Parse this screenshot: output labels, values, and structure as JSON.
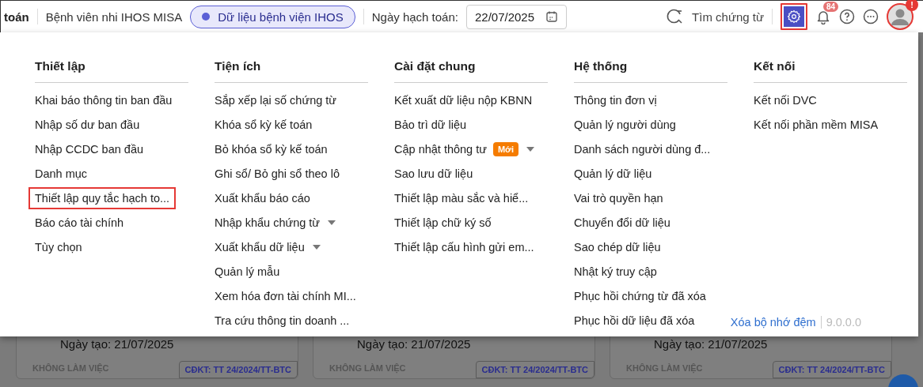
{
  "header": {
    "app_title": "toán",
    "unit_name": "Bệnh viên nhi IHOS MISA",
    "data_pill": "Dữ liệu bệnh viện IHOS",
    "date_label": "Ngày hạch toán:",
    "date_value": "22/07/2025",
    "search_label": "Tìm chứng từ",
    "settings_highlighted": true,
    "notification_count": "84",
    "avatar_alert": "!"
  },
  "menu": {
    "columns": [
      {
        "title": "Thiết lập",
        "items": [
          {
            "label": "Khai báo thông tin ban đầu"
          },
          {
            "label": "Nhập số dư ban đầu"
          },
          {
            "label": "Nhập CCDC ban đầu"
          },
          {
            "label": "Danh mục"
          },
          {
            "label": "Thiết lập quy tắc hạch to...",
            "highlighted": true
          },
          {
            "label": "Báo cáo tài chính"
          },
          {
            "label": "Tùy chọn"
          }
        ]
      },
      {
        "title": "Tiện ích",
        "items": [
          {
            "label": "Sắp xếp lại số chứng từ"
          },
          {
            "label": "Khóa sổ kỳ kế toán"
          },
          {
            "label": "Bỏ khóa sổ kỳ kế toán"
          },
          {
            "label": "Ghi sổ/ Bỏ ghi sổ theo lô"
          },
          {
            "label": "Xuất khẩu báo cáo"
          },
          {
            "label": "Nhập khẩu chứng từ",
            "caret": true
          },
          {
            "label": "Xuất khẩu dữ liệu",
            "caret": true
          },
          {
            "label": "Quản lý mẫu"
          },
          {
            "label": "Xem hóa đơn tài chính MI..."
          },
          {
            "label": "Tra cứu thông tin doanh ..."
          }
        ]
      },
      {
        "title": "Cài đặt chung",
        "items": [
          {
            "label": "Kết xuất dữ liệu nộp KBNN"
          },
          {
            "label": "Bảo trì dữ liệu"
          },
          {
            "label": "Cập nhật thông tư",
            "badge": "Mới",
            "caret": true
          },
          {
            "label": "Sao lưu dữ liệu"
          },
          {
            "label": "Thiết lập màu sắc và hiể..."
          },
          {
            "label": "Thiết lập chữ ký số"
          },
          {
            "label": "Thiết lập cấu hình gửi em..."
          }
        ]
      },
      {
        "title": "Hệ thống",
        "items": [
          {
            "label": "Thông tin đơn vị"
          },
          {
            "label": "Quản lý người dùng"
          },
          {
            "label": "Danh sách người dùng đ..."
          },
          {
            "label": "Quản lý dữ liệu"
          },
          {
            "label": "Vai trò quyền hạn"
          },
          {
            "label": "Chuyển đổi dữ liệu"
          },
          {
            "label": "Sao chép dữ liệu"
          },
          {
            "label": "Nhật ký truy cập"
          },
          {
            "label": "Phục hồi chứng từ đã xóa"
          },
          {
            "label": "Phục hồi dữ liệu đã xóa"
          }
        ]
      },
      {
        "title": "Kết nối",
        "items": [
          {
            "label": "Kết nối DVC"
          },
          {
            "label": "Kết nối phần mềm MISA"
          }
        ]
      }
    ],
    "clear_cache": "Xóa bộ nhớ đệm",
    "version": "9.0.0.0"
  },
  "cards": [
    {
      "created": "Ngày tạo: 21/07/2025",
      "status": "KHÔNG LÀM VIỆC",
      "tag": "CĐKT: TT 24/2024/TT-BTC"
    },
    {
      "created": "Ngày tạo: 21/07/2025",
      "status": "KHÔNG LÀM VIỆC",
      "tag": "CĐKT: TT 24/2024/TT-BTC"
    },
    {
      "created": "Ngày tạo: 21/07/2025",
      "status": "KHÔNG LÀM VIỆC",
      "tag": "CĐKT: TT 24/2024/TT-BTC"
    }
  ]
}
